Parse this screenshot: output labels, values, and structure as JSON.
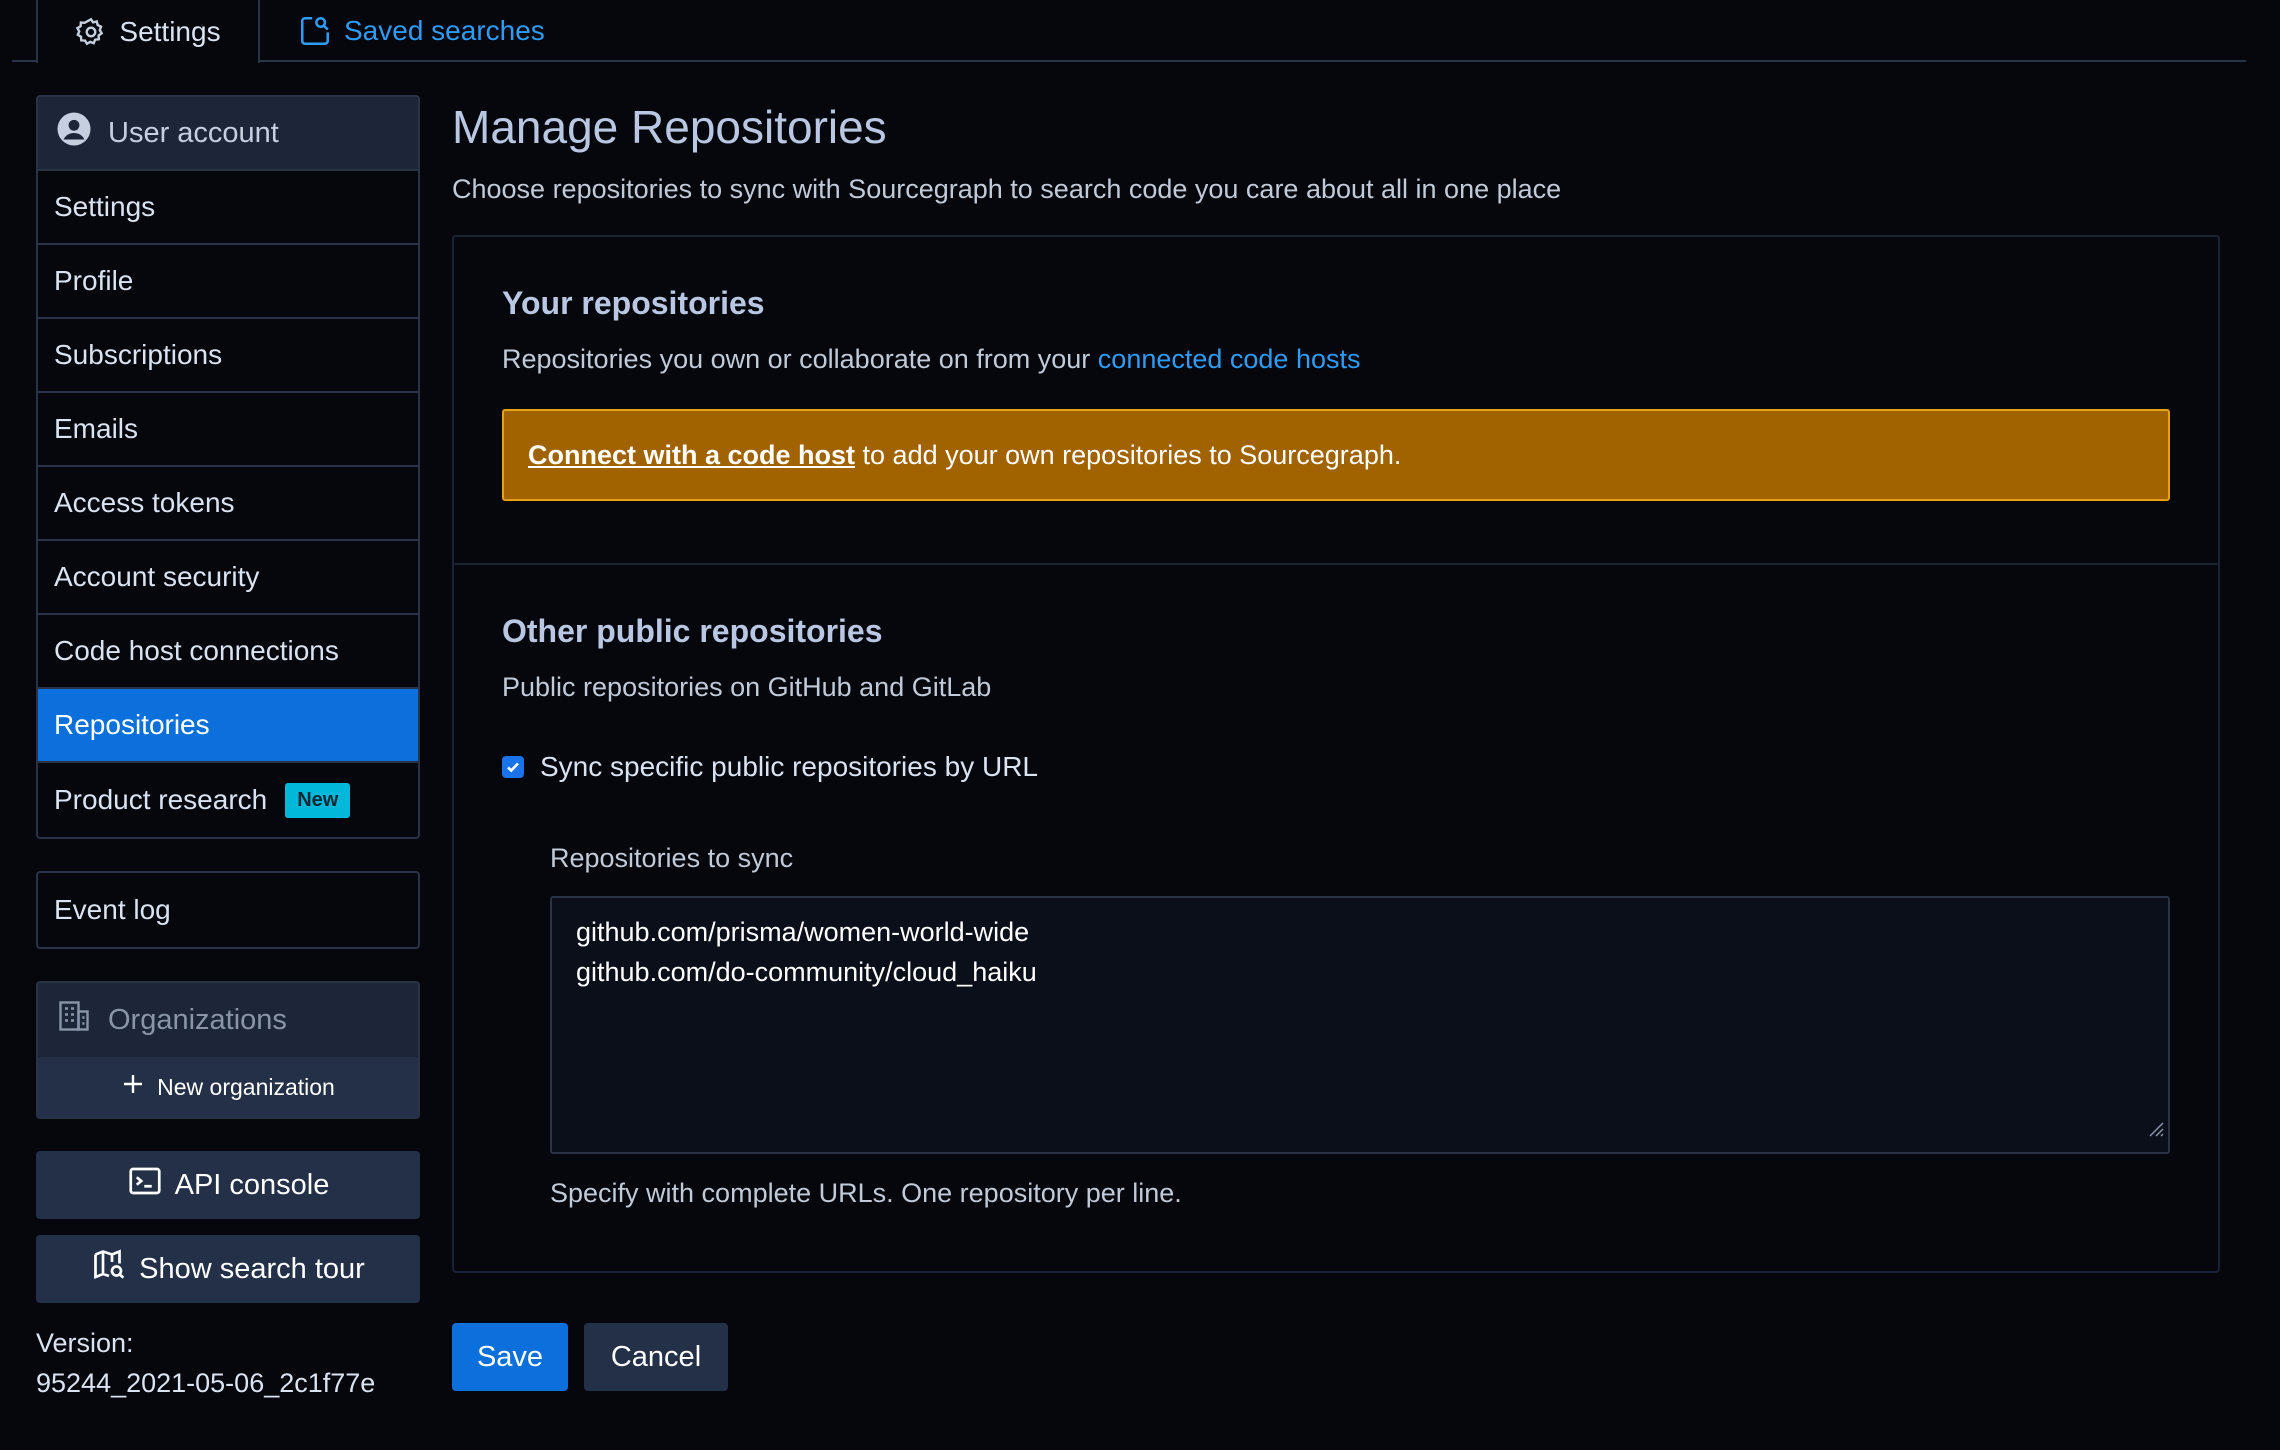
{
  "tabs": {
    "settings_label": "Settings",
    "saved_searches_label": "Saved searches"
  },
  "sidebar": {
    "header": "User account",
    "items": [
      {
        "label": "Settings"
      },
      {
        "label": "Profile"
      },
      {
        "label": "Subscriptions"
      },
      {
        "label": "Emails"
      },
      {
        "label": "Access tokens"
      },
      {
        "label": "Account security"
      },
      {
        "label": "Code host connections"
      },
      {
        "label": "Repositories"
      },
      {
        "label": "Product research",
        "badge": "New"
      }
    ],
    "event_log": "Event log",
    "organizations_header": "Organizations",
    "new_organization": "New organization",
    "api_console": "API console",
    "show_search_tour": "Show search tour",
    "version_label": "Version:",
    "version_value": "95244_2021-05-06_2c1f77e"
  },
  "main": {
    "title": "Manage Repositories",
    "subtitle": "Choose repositories to sync with Sourcegraph to search code you care about all in one place",
    "your_repos": {
      "heading": "Your repositories",
      "desc_prefix": "Repositories you own or collaborate on from your ",
      "desc_link": "connected code hosts",
      "alert_link": "Connect with a code host",
      "alert_rest": " to add your own repositories to Sourcegraph."
    },
    "public_repos": {
      "heading": "Other public repositories",
      "desc": "Public repositories on GitHub and GitLab",
      "checkbox_label": "Sync specific public repositories by URL",
      "checkbox_checked": true,
      "field_label": "Repositories to sync",
      "repos": [
        "github.com/prisma/women-world-wide",
        "github.com/do-community/cloud_haiku"
      ],
      "help": "Specify with complete URLs. One repository per line."
    },
    "save_label": "Save",
    "cancel_label": "Cancel"
  },
  "colors": {
    "background": "#05070d",
    "primary": "#0b70db",
    "link": "#2d9cf5",
    "warning": "#a16200",
    "badge": "#00b8d9"
  }
}
